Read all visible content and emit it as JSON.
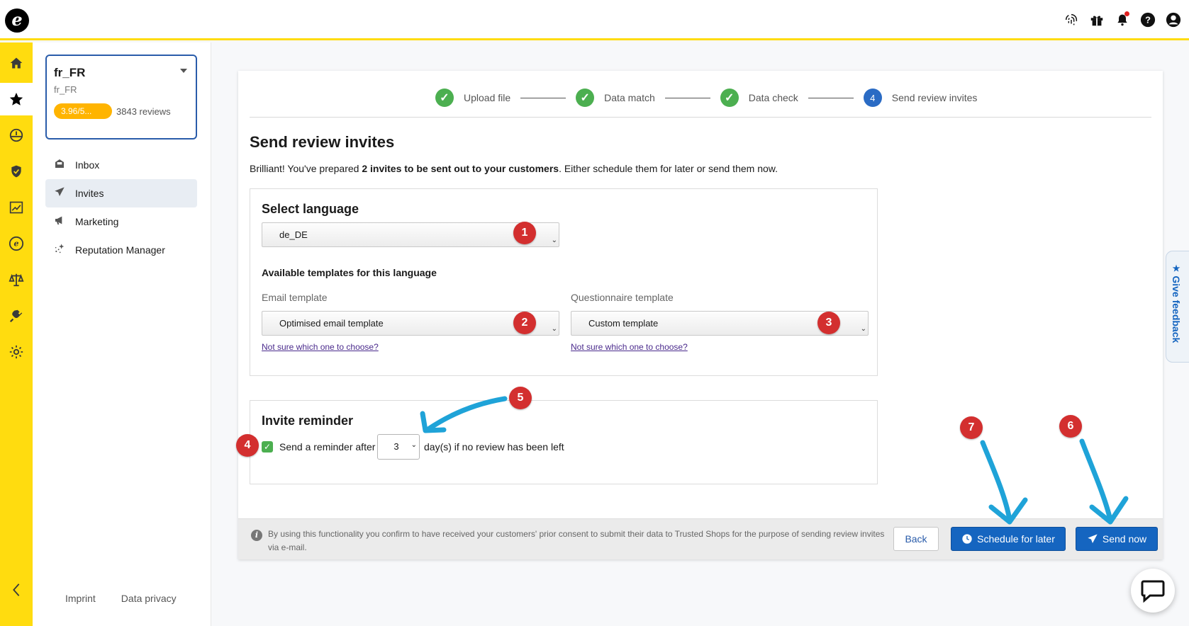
{
  "app": {
    "logo_letter": "e",
    "brand_color": "#ffdc0f",
    "accent_color": "#1565c0"
  },
  "topbar": {
    "icons": [
      "fingerprint-icon",
      "gift-icon",
      "bell-icon",
      "help-icon",
      "user-icon"
    ]
  },
  "rail": {
    "items": [
      "home-icon",
      "star-icon",
      "dashboard-icon",
      "shield-icon",
      "chart-icon",
      "trusted-icon",
      "balance-icon",
      "plug-icon",
      "gear-icon"
    ],
    "collapse_icon": "chevron-left-icon"
  },
  "shop": {
    "name": "fr_FR",
    "sub": "fr_FR",
    "rating": "3.96/5...",
    "reviews": "3843 reviews"
  },
  "nav": {
    "inbox": "Inbox",
    "invites": "Invites",
    "marketing": "Marketing",
    "reputation": "Reputation Manager"
  },
  "side_footer": {
    "imprint": "Imprint",
    "privacy": "Data privacy"
  },
  "stepper": {
    "step1": "Upload file",
    "step2": "Data match",
    "step3": "Data check",
    "step4_num": "4",
    "step4": "Send review invites"
  },
  "main": {
    "title": "Send review invites",
    "intro_pre": "Brilliant! You've prepared ",
    "intro_bold": "2 invites to be sent out to your customers",
    "intro_post": ". Either schedule them for later or send them now."
  },
  "language": {
    "title": "Select language",
    "value": "de_DE",
    "templates_head": "Available templates for this language",
    "email_label": "Email template",
    "email_value": "Optimised email template",
    "questionnaire_label": "Questionnaire template",
    "questionnaire_value": "Custom template",
    "help_link": "Not sure which one to choose?"
  },
  "reminder": {
    "title": "Invite reminder",
    "label_pre": "Send a reminder after",
    "days": "3",
    "label_post": "day(s) if no review has been left"
  },
  "footer": {
    "consent": "By using this functionality you confirm to have received your customers' prior consent to submit their data to Trusted Shops for the purpose of sending review invites via e-mail.",
    "back": "Back",
    "schedule": "Schedule for later",
    "send": "Send now"
  },
  "badges": [
    "1",
    "2",
    "3",
    "4",
    "5",
    "6",
    "7"
  ],
  "feedback": "Give feedback"
}
